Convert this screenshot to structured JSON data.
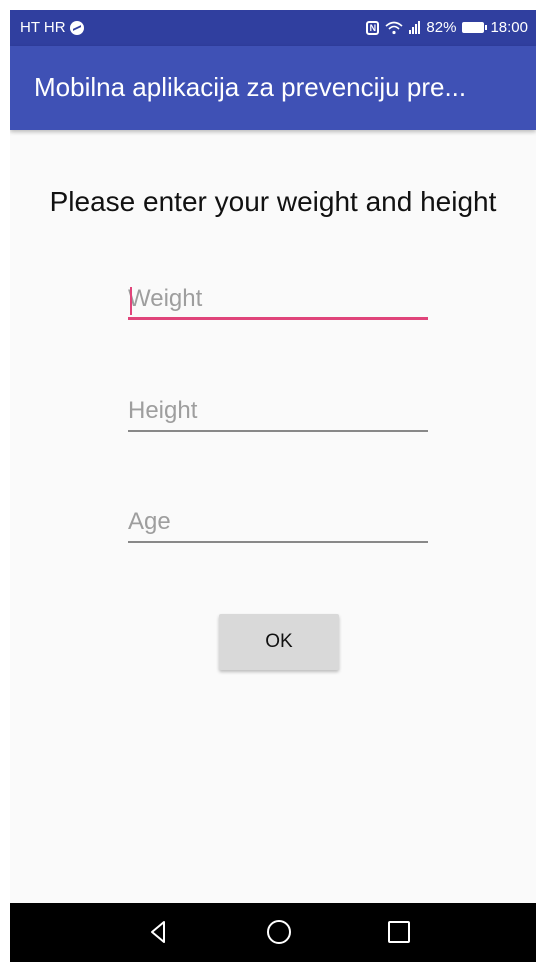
{
  "status_bar": {
    "carrier": "HT HR",
    "nfc_label": "N",
    "battery_percent": "82%",
    "time": "18:00",
    "icons": [
      "messenger-icon",
      "nfc-icon",
      "wifi-icon",
      "signal-icon",
      "battery-icon"
    ]
  },
  "app_bar": {
    "title": "Mobilna aplikacija za prevenciju pre..."
  },
  "main": {
    "prompt": "Please enter your weight and height",
    "fields": [
      {
        "placeholder": "Weight",
        "value": "",
        "focused": true
      },
      {
        "placeholder": "Height",
        "value": ""
      },
      {
        "placeholder": "Age",
        "value": ""
      }
    ],
    "ok_label": "OK"
  },
  "nav_bar": {
    "buttons": [
      "back-icon",
      "home-icon",
      "recents-icon"
    ]
  },
  "colors": {
    "status_bar": "#303f9f",
    "app_bar": "#3f51b5",
    "accent": "#e0447a",
    "background": "#fafafa"
  }
}
